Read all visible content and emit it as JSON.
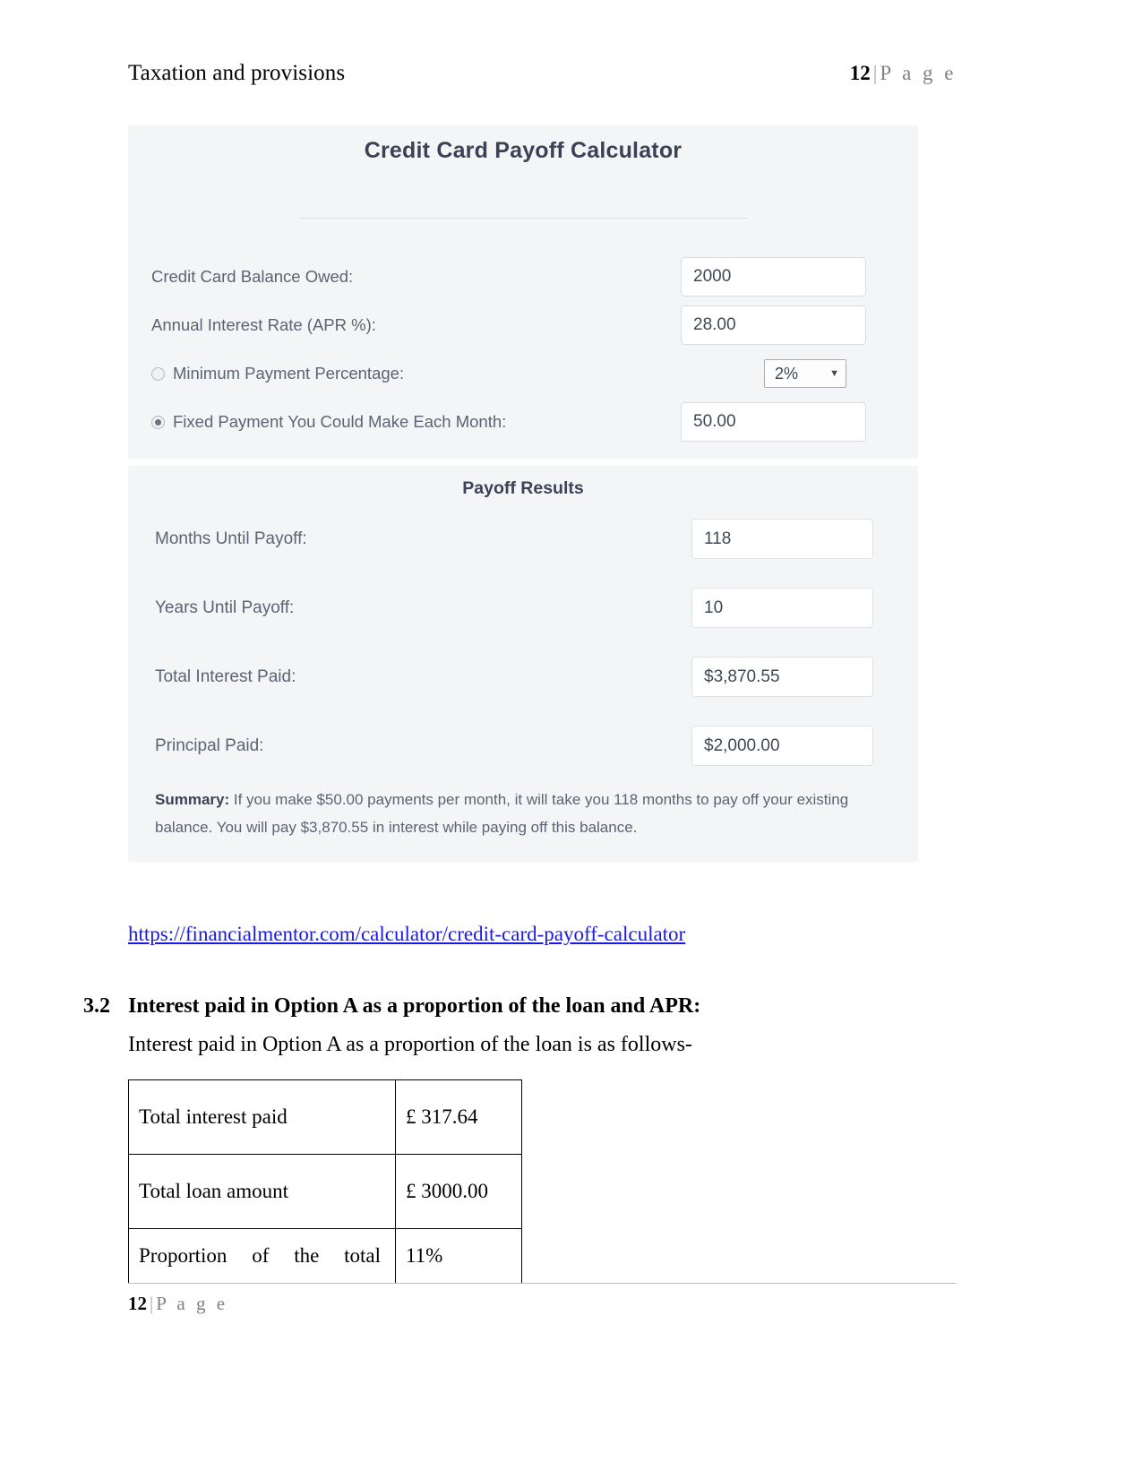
{
  "header": {
    "title": "Taxation and provisions",
    "page_number": "12",
    "separator": "|",
    "page_word": "P a g e"
  },
  "calculator": {
    "title": "Credit Card Payoff Calculator",
    "inputs": [
      {
        "label": "Credit Card Balance Owed:",
        "value": "2000"
      },
      {
        "label": "Annual Interest Rate (APR %):",
        "value": "28.00"
      }
    ],
    "minimum_payment": {
      "label": "Minimum Payment Percentage:",
      "selected_option": "2%",
      "caret": "▼",
      "radio_selected": false
    },
    "fixed_payment": {
      "label": "Fixed Payment You Could Make Each Month:",
      "value": "50.00",
      "radio_selected": true
    },
    "results": {
      "title": "Payoff Results",
      "rows": [
        {
          "label": "Months Until Payoff:",
          "value": "118"
        },
        {
          "label": "Years Until Payoff:",
          "value": "10"
        },
        {
          "label": "Total Interest Paid:",
          "value": "$3,870.55"
        },
        {
          "label": "Principal Paid:",
          "value": "$2,000.00"
        }
      ],
      "summary_label": "Summary:",
      "summary_text": " If you make $50.00 payments per month, it will take you 118 months to pay off your existing balance. You will pay $3,870.55 in interest while paying off this balance."
    }
  },
  "source_link": "https://financialmentor.com/calculator/credit-card-payoff-calculator",
  "section": {
    "number": "3.2",
    "heading": "Interest paid in Option A as a proportion of the loan and APR:",
    "paragraph": "Interest paid in Option A as a proportion of the loan is as follows-"
  },
  "table": {
    "rows": [
      {
        "label": "Total interest paid",
        "value": "£ 317.64"
      },
      {
        "label": "Total loan amount",
        "value": "£ 3000.00"
      },
      {
        "label": "Proportion  of  the  total",
        "value": "11%"
      }
    ]
  },
  "footer": {
    "page_number": "12",
    "separator": "|",
    "page_word": "P a g e"
  }
}
